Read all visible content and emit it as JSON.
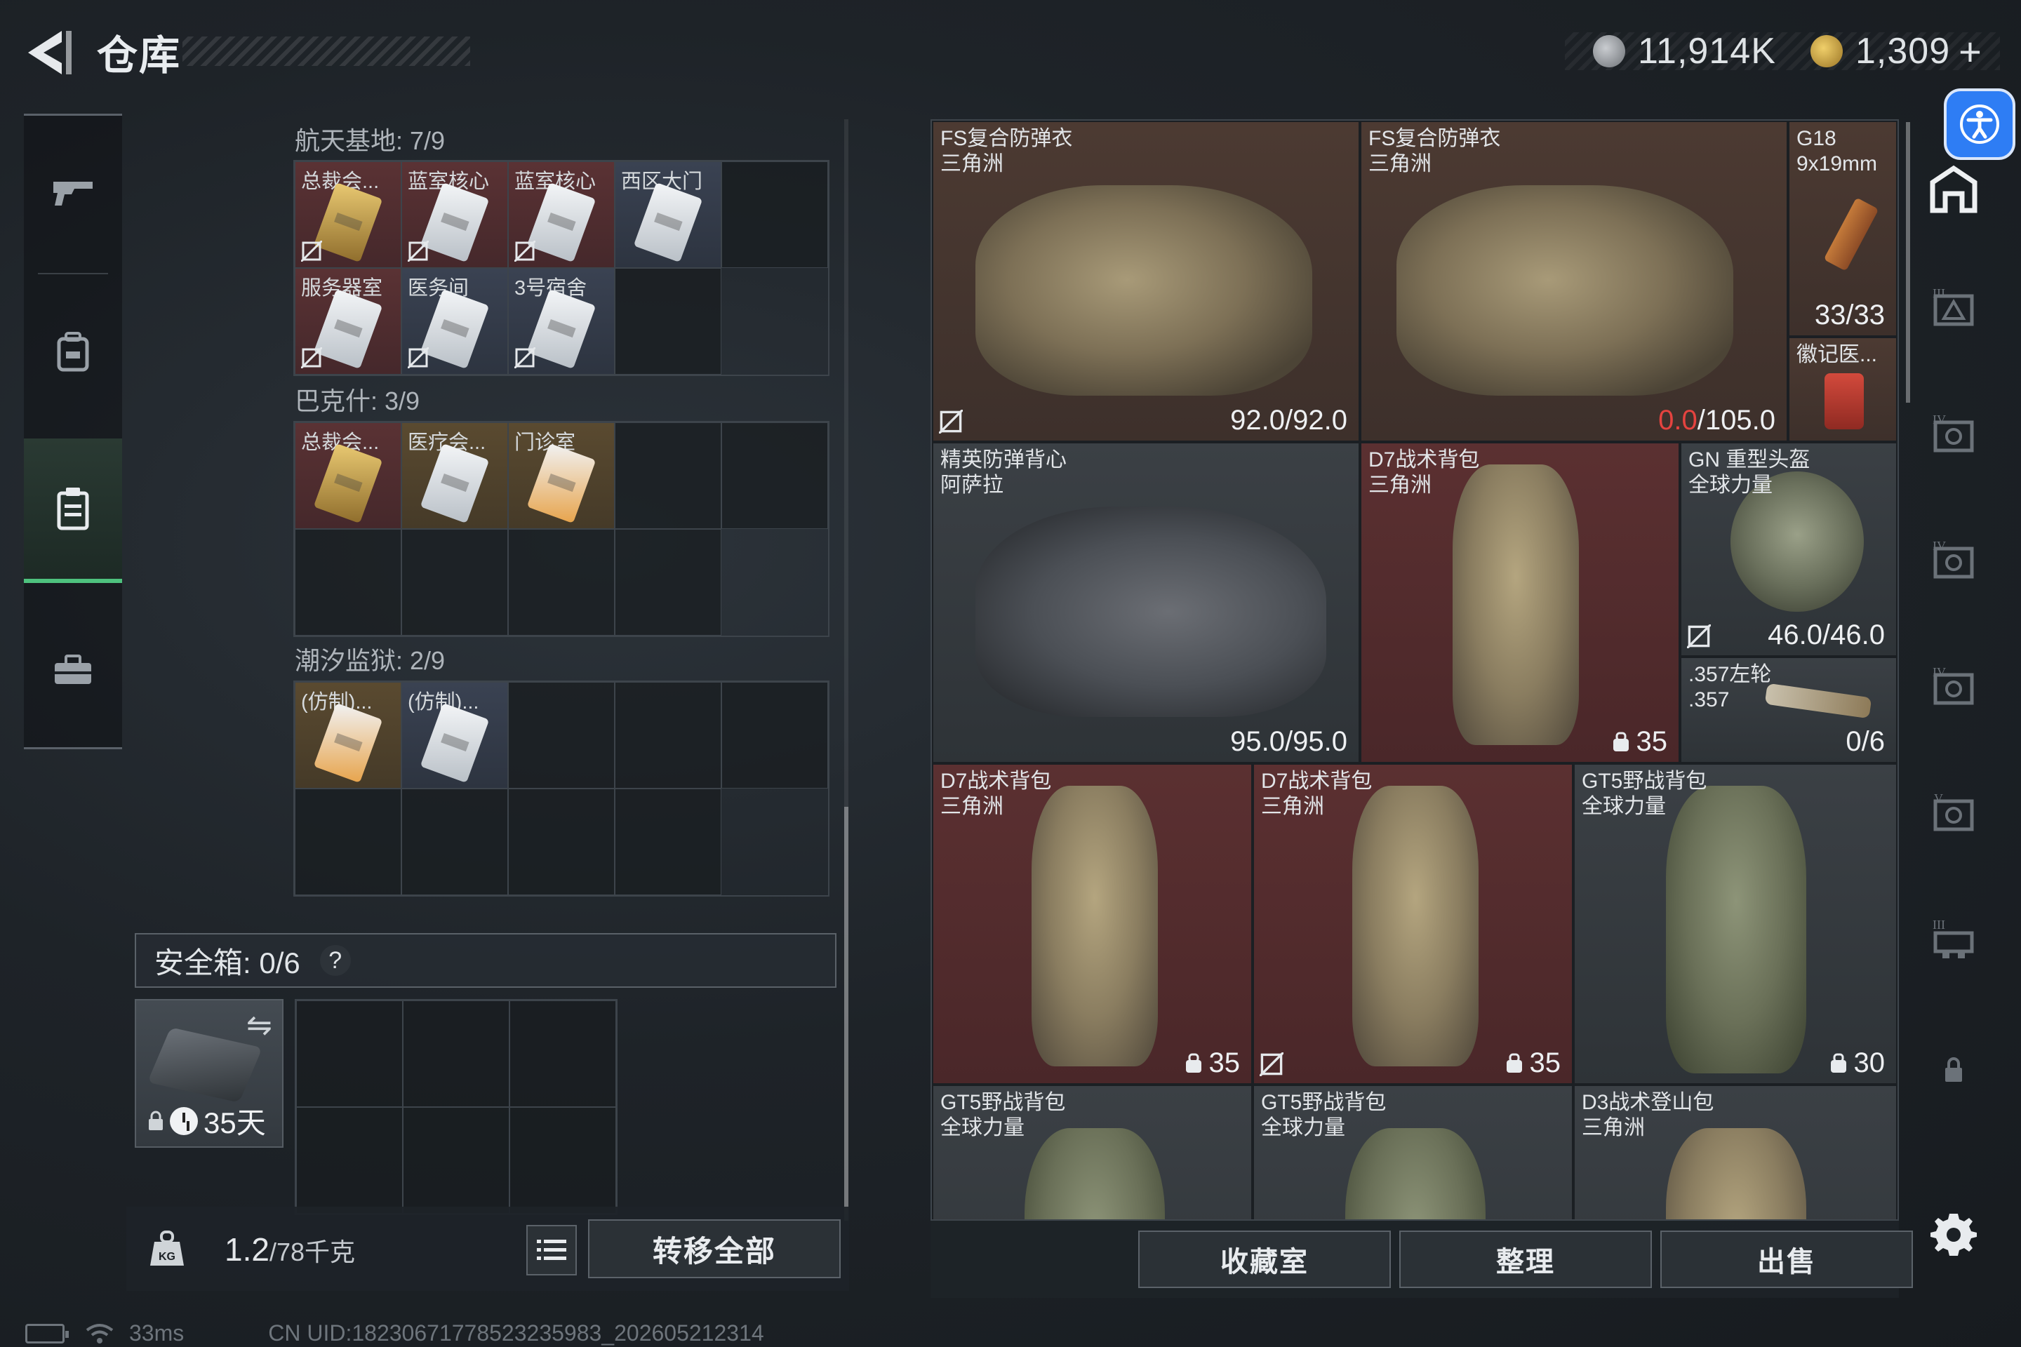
{
  "header": {
    "title": "仓库",
    "currency_primary": "11,914K",
    "currency_secondary": "1,309",
    "add_symbol": "+"
  },
  "left_panel": {
    "sections": [
      {
        "title": "航天基地: 7/9",
        "cells": [
          {
            "label": "总裁会...",
            "card": "gold",
            "tint": "red",
            "no_trade": true
          },
          {
            "label": "蓝室核心",
            "card": "white",
            "tint": "red",
            "no_trade": true
          },
          {
            "label": "蓝室核心",
            "card": "white",
            "tint": "red",
            "no_trade": true
          },
          {
            "label": "西区大门",
            "card": "white",
            "tint": "blue",
            "no_trade": false
          },
          {
            "label": "服务器室",
            "card": "white",
            "tint": "red",
            "no_trade": true
          },
          {
            "label": "医务间",
            "card": "white",
            "tint": "blue",
            "no_trade": true
          },
          {
            "label": "3号宿舍",
            "card": "white",
            "tint": "blue",
            "no_trade": true
          }
        ]
      },
      {
        "title": "巴克什: 3/9",
        "cells": [
          {
            "label": "总裁会...",
            "card": "gold",
            "tint": "red",
            "no_trade": false
          },
          {
            "label": "医疗会...",
            "card": "white",
            "tint": "gold",
            "no_trade": false
          },
          {
            "label": "门诊室",
            "card": "orange",
            "tint": "gold",
            "no_trade": false
          }
        ]
      },
      {
        "title": "潮汐监狱: 2/9",
        "cells": [
          {
            "label": "(仿制)...",
            "card": "orange",
            "tint": "gold",
            "no_trade": false
          },
          {
            "label": "(仿制)...",
            "card": "white",
            "tint": "blue",
            "no_trade": false
          }
        ]
      }
    ],
    "safebox": {
      "label": "安全箱: 0/6",
      "help": "?",
      "timer": "35天"
    },
    "weight": "1.2",
    "weight_max": "/78千克",
    "transfer_all": "转移全部"
  },
  "right_panel": {
    "slots": [
      {
        "name": "FS复合防弹衣\n三角洲",
        "dur": "92.0/92.0",
        "dur_red": ""
      },
      {
        "name": "FS复合防弹衣\n三角洲",
        "dur": "/105.0",
        "dur_red": "0.0"
      },
      {
        "name": "G18\n9x19mm",
        "ammo": "33/33"
      },
      {
        "name": "徽记医..."
      },
      {
        "name": "精英防弹背心\n阿萨拉",
        "dur": "95.0/95.0"
      },
      {
        "name": "D7战术背包\n三角洲",
        "cap": "35"
      },
      {
        "name": "GN 重型头盔\n全球力量",
        "dur": "46.0/46.0"
      },
      {
        "name": ".357左轮\n.357",
        "ammo": "0/6"
      },
      {
        "name": "D7战术背包\n三角洲",
        "cap": "35"
      },
      {
        "name": "D7战术背包\n三角洲",
        "cap": "35"
      },
      {
        "name": "GT5野战背包\n全球力量",
        "cap": "30"
      },
      {
        "name": "GT5野战背包\n全球力量"
      },
      {
        "name": "GT5野战背包\n全球力量"
      },
      {
        "name": "D3战术登山包\n三角洲"
      }
    ],
    "buttons": {
      "collection": "收藏室",
      "organize": "整理",
      "sell": "出售"
    }
  },
  "status": {
    "ping": "33ms",
    "uid": "CN UID:1823067177852323598​3_202605212314"
  },
  "colors": {
    "accent_green": "#4ec27e",
    "rarity_red": "#5b3031",
    "rarity_gold": "#5a4a30",
    "durability_red": "#e5433f",
    "accessibility_blue": "#2e7df4"
  }
}
